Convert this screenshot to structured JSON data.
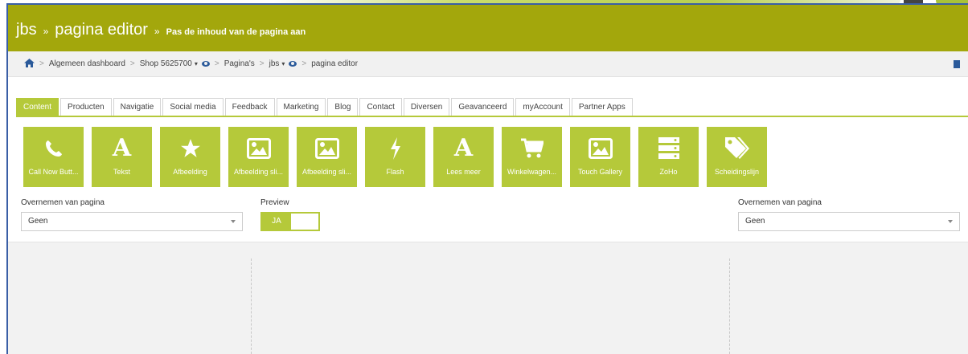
{
  "header": {
    "title": "jbs",
    "sep1": "»",
    "page": "pagina editor",
    "sep2": "»",
    "subtitle": "Pas de inhoud van de pagina aan"
  },
  "breadcrumb": {
    "sep": ">",
    "items": [
      "Algemeen dashboard",
      "Shop 5625700",
      "Pagina's",
      "jbs",
      "pagina editor"
    ],
    "caret": "▾"
  },
  "tabs": [
    "Content",
    "Producten",
    "Navigatie",
    "Social media",
    "Feedback",
    "Marketing",
    "Blog",
    "Contact",
    "Diversen",
    "Geavanceerd",
    "myAccount",
    "Partner Apps"
  ],
  "tiles": [
    {
      "label": "Call Now Butt...",
      "icon": "phone-icon"
    },
    {
      "label": "Tekst",
      "icon": "text-a-icon",
      "glyph": "A"
    },
    {
      "label": "Afbeelding",
      "icon": "star-icon"
    },
    {
      "label": "Afbeelding sli...",
      "icon": "image-icon"
    },
    {
      "label": "Afbeelding sli...",
      "icon": "image-icon"
    },
    {
      "label": "Flash",
      "icon": "flash-icon"
    },
    {
      "label": "Lees meer",
      "icon": "text-a-icon",
      "glyph": "A"
    },
    {
      "label": "Winkelwagen...",
      "icon": "cart-icon"
    },
    {
      "label": "Touch Gallery",
      "icon": "image-icon"
    },
    {
      "label": "ZoHo",
      "icon": "server-icon"
    },
    {
      "label": "Scheidingslijn",
      "icon": "tags-icon"
    }
  ],
  "controls": {
    "left_label": "Overnemen van pagina",
    "left_value": "Geen",
    "preview_label": "Preview",
    "preview_value": "JA",
    "right_label": "Overnemen van pagina",
    "right_value": "Geen"
  },
  "colors": {
    "header": "#a3a70c",
    "accent": "#b5c93a",
    "link": "#2b5a9a"
  }
}
